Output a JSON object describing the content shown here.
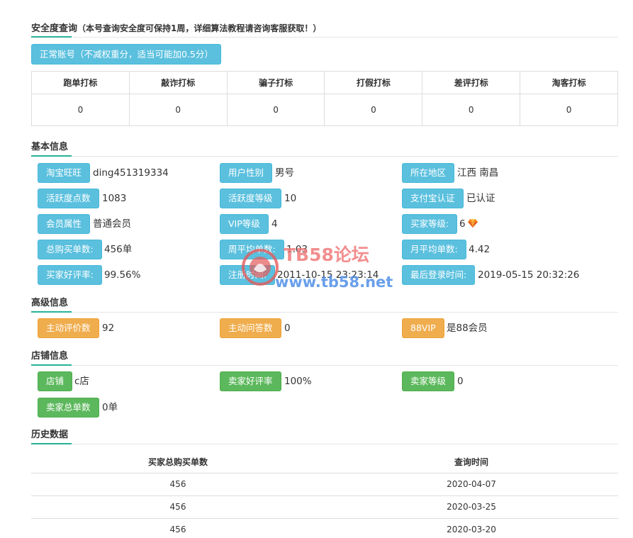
{
  "safety": {
    "title": "安全度查询",
    "subtitle": "（本号查询安全度可保持1周，详细算法教程请咨询客服获取！）",
    "status": "正常账号（不减权重分，适当可能加0.5分）",
    "marks": {
      "headers": [
        "跑单打标",
        "敲诈打标",
        "骗子打标",
        "打假打标",
        "差评打标",
        "淘客打标"
      ],
      "values": [
        "0",
        "0",
        "0",
        "0",
        "0",
        "0"
      ]
    }
  },
  "basic": {
    "title": "基本信息",
    "rows": [
      [
        {
          "label": "淘宝旺旺",
          "value": "ding451319334"
        },
        {
          "label": "用户性别",
          "value": "男号"
        },
        {
          "label": "所在地区",
          "value": "江西 南昌"
        }
      ],
      [
        {
          "label": "活跃度点数",
          "value": "1083"
        },
        {
          "label": "活跃度等级",
          "value": "10"
        },
        {
          "label": "支付宝认证",
          "value": "已认证"
        }
      ],
      [
        {
          "label": "会员属性",
          "value": "普通会员"
        },
        {
          "label": "VIP等级",
          "value": "4"
        },
        {
          "label": "买家等级:",
          "value": "6"
        }
      ],
      [
        {
          "label": "总购买单数:",
          "value": "456单"
        },
        {
          "label": "周平均单数:",
          "value": "1.03"
        },
        {
          "label": "月平均单数:",
          "value": "4.42"
        }
      ],
      [
        {
          "label": "买家好评率:",
          "value": "99.56%"
        },
        {
          "label": "注册时间:",
          "value": "2011-10-15 23:23:14"
        },
        {
          "label": "最后登录时间:",
          "value": "2019-05-15 20:32:26"
        }
      ]
    ],
    "buyer_level_icon": "diamond-icon"
  },
  "advanced": {
    "title": "高级信息",
    "items": [
      {
        "label": "主动评价数",
        "value": "92"
      },
      {
        "label": "主动问答数",
        "value": "0"
      },
      {
        "label": "88VIP",
        "value": "是88会员"
      }
    ]
  },
  "shop": {
    "title": "店铺信息",
    "items": [
      {
        "label": "店铺",
        "value": "c店"
      },
      {
        "label": "卖家好评率",
        "value": "100%"
      },
      {
        "label": "卖家等级",
        "value": "0"
      },
      {
        "label": "卖家总单数",
        "value": "0单"
      }
    ]
  },
  "history": {
    "title": "历史数据",
    "headers": [
      "买家总购买单数",
      "查询时间"
    ],
    "rows": [
      [
        "456",
        "2020-04-07"
      ],
      [
        "456",
        "2020-03-25"
      ],
      [
        "456",
        "2020-03-20"
      ]
    ]
  },
  "watermark": {
    "line1": "TB58论坛",
    "line2": "www.tb58.net"
  },
  "colors": {
    "info": "#5bc0de",
    "warning": "#f0ad4e",
    "success": "#5cb85c",
    "accent": "#26b29a"
  }
}
